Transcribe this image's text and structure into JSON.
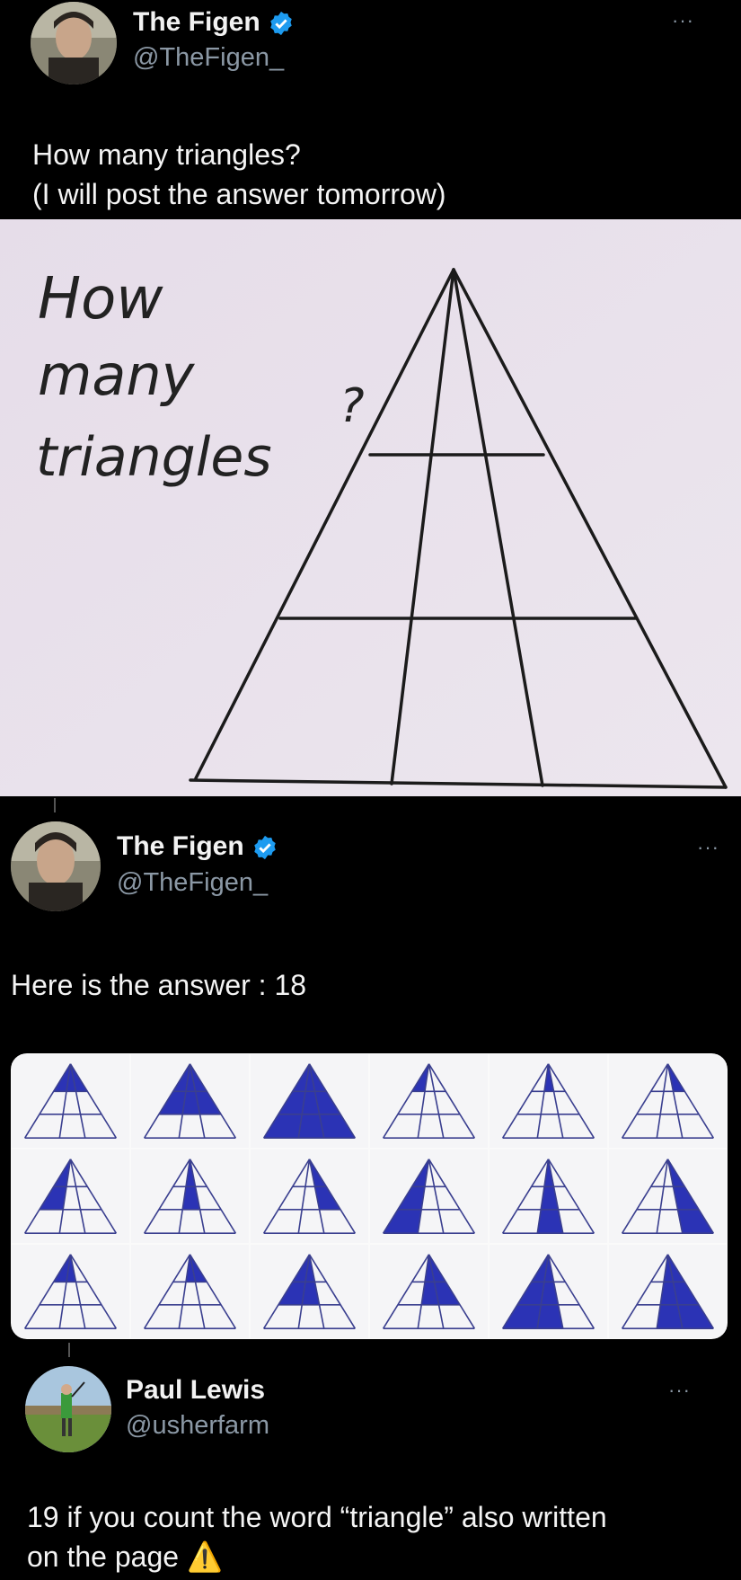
{
  "tweet1": {
    "name": "The Figen",
    "handle": "@TheFigen_",
    "more": "···",
    "text_line1": "How many triangles?",
    "text_line2": "(I will post the answer tomorrow)",
    "image_words": [
      "How",
      "many",
      "triangles",
      "?"
    ]
  },
  "tweet2": {
    "name": "The Figen",
    "handle": "@TheFigen_",
    "more": "···",
    "text": "Here is the answer : 18",
    "answer_count": 18
  },
  "tweet3": {
    "name": "Paul Lewis",
    "handle": "@usherfarm",
    "more": "···",
    "text_line1": "19 if you count the word “triangle” also written",
    "text_line2": "on the page",
    "emoji": "⚠️"
  },
  "colors": {
    "background": "#000000",
    "verified": "#1d9bf0",
    "highlight_fill": "#2b33b5",
    "paper": "#e3dcea"
  }
}
